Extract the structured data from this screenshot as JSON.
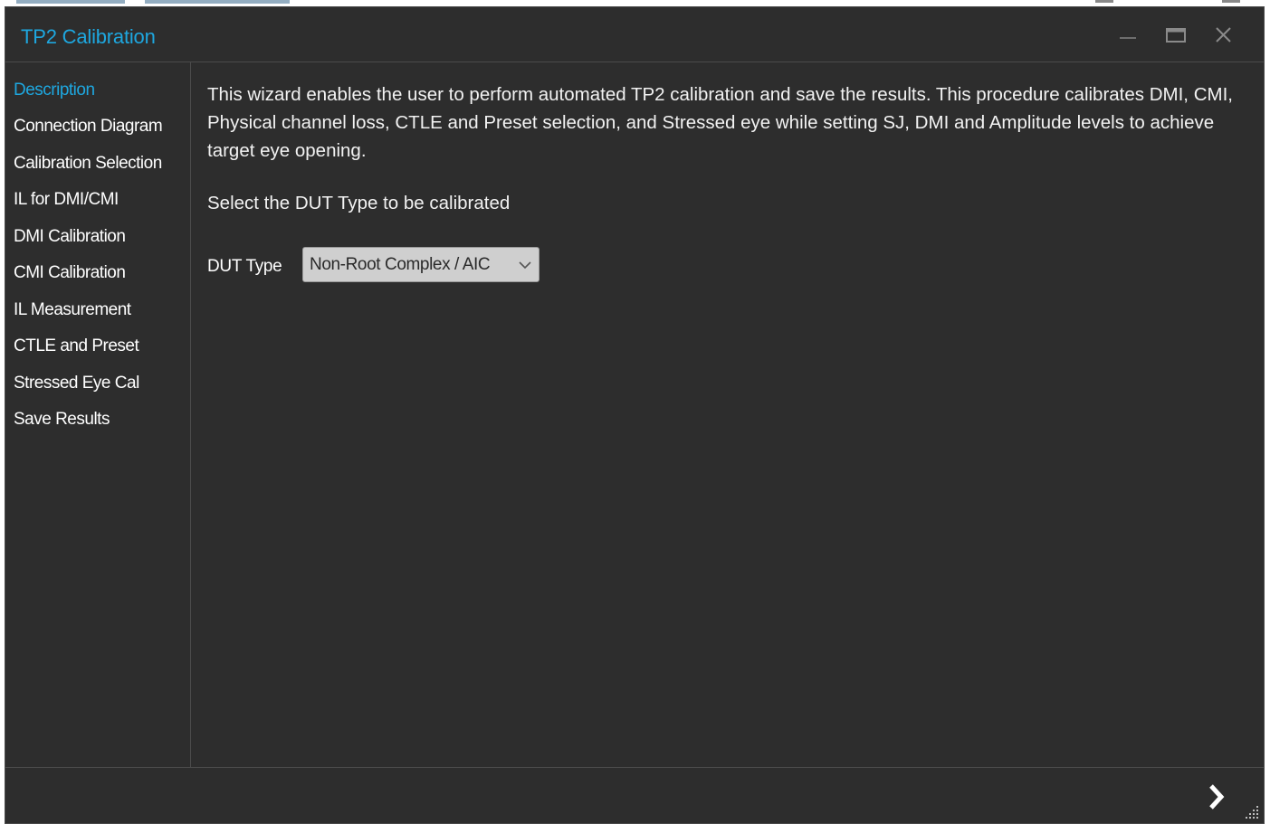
{
  "window": {
    "title": "TP2 Calibration",
    "controls": [
      "minimize-icon",
      "maximize-icon",
      "close-icon"
    ],
    "accent_color": "#1ea7df",
    "background_color": "#2d2d2d"
  },
  "sidebar": {
    "items": [
      {
        "label": "Description",
        "active": true
      },
      {
        "label": "Connection Diagram",
        "active": false
      },
      {
        "label": "Calibration Selection",
        "active": false
      },
      {
        "label": "IL for DMI/CMI",
        "active": false
      },
      {
        "label": "DMI Calibration",
        "active": false
      },
      {
        "label": "CMI Calibration",
        "active": false
      },
      {
        "label": "IL Measurement",
        "active": false
      },
      {
        "label": "CTLE and Preset",
        "active": false
      },
      {
        "label": "Stressed Eye Cal",
        "active": false
      },
      {
        "label": "Save Results",
        "active": false
      }
    ]
  },
  "main": {
    "description": "This wizard enables the user to perform automated TP2 calibration and save the results. This procedure calibrates DMI, CMI, Physical channel loss, CTLE and Preset selection, and Stressed eye while setting SJ, DMI and Amplitude levels to achieve target eye opening.",
    "prompt": "Select the DUT Type to be calibrated",
    "dut_type": {
      "label": "DUT Type",
      "selected": "Non-Root Complex / AIC"
    }
  },
  "footer": {
    "next_icon": "chevron-right-icon",
    "resize_icon": "resize-grip-icon"
  }
}
